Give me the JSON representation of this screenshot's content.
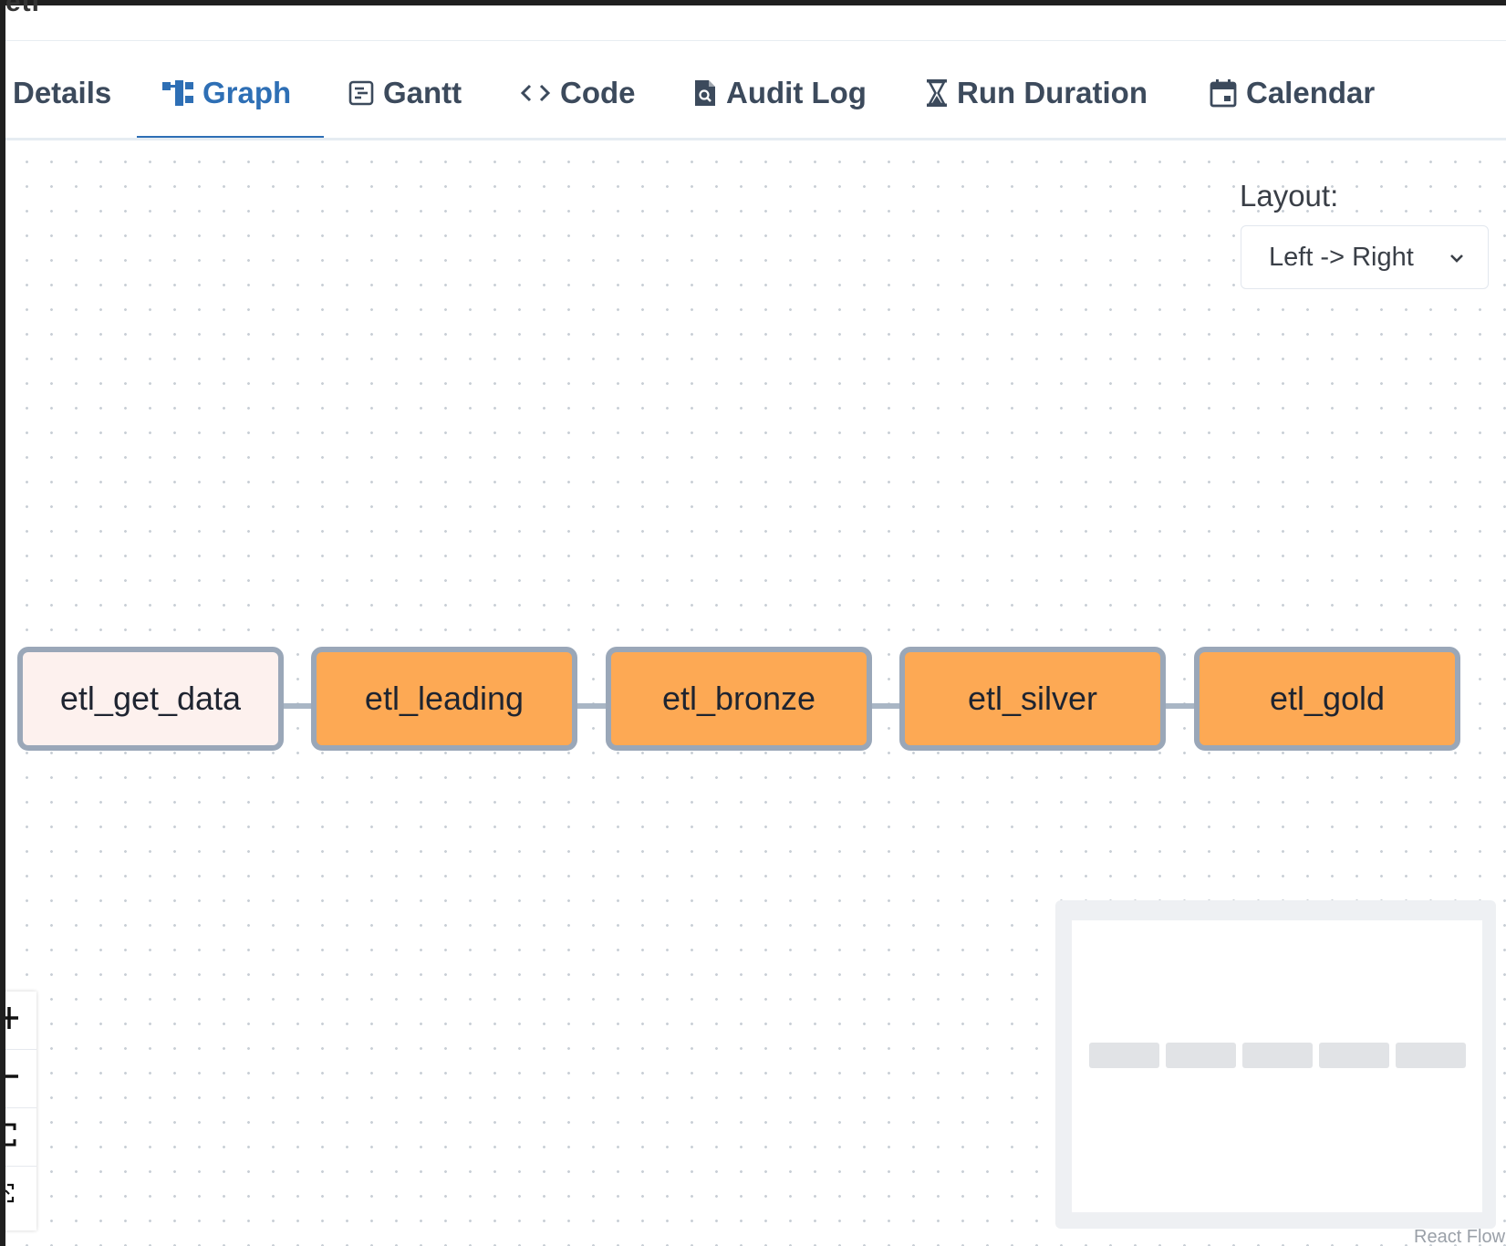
{
  "dag_title": "etl",
  "tabs": [
    {
      "label": "Details",
      "icon": "none",
      "active": false
    },
    {
      "label": "Graph",
      "icon": "graph-icon",
      "active": true
    },
    {
      "label": "Gantt",
      "icon": "gantt-icon",
      "active": false
    },
    {
      "label": "Code",
      "icon": "code-icon",
      "active": false
    },
    {
      "label": "Audit Log",
      "icon": "audit-log-icon",
      "active": false
    },
    {
      "label": "Run Duration",
      "icon": "hourglass-icon",
      "active": false
    },
    {
      "label": "Calendar",
      "icon": "calendar-icon",
      "active": false
    }
  ],
  "layout": {
    "label": "Layout:",
    "selected": "Left -> Right"
  },
  "graph": {
    "nodes": [
      {
        "id": "etl_get_data",
        "state": "queued",
        "color": "#fdf1ee"
      },
      {
        "id": "etl_leading",
        "state": "running",
        "color": "#fda954"
      },
      {
        "id": "etl_bronze",
        "state": "running",
        "color": "#fda954"
      },
      {
        "id": "etl_silver",
        "state": "running",
        "color": "#fda954"
      },
      {
        "id": "etl_gold",
        "state": "running",
        "color": "#fda954"
      }
    ]
  },
  "controls": [
    "zoom-in-icon",
    "zoom-out-icon",
    "fit-view-icon",
    "interactive-toggle-icon"
  ],
  "attribution": "React Flow",
  "colors": {
    "accent": "#2e6fb5",
    "node_border": "#9aa7b8",
    "running": "#fda954",
    "queued": "#fdf1ee"
  }
}
